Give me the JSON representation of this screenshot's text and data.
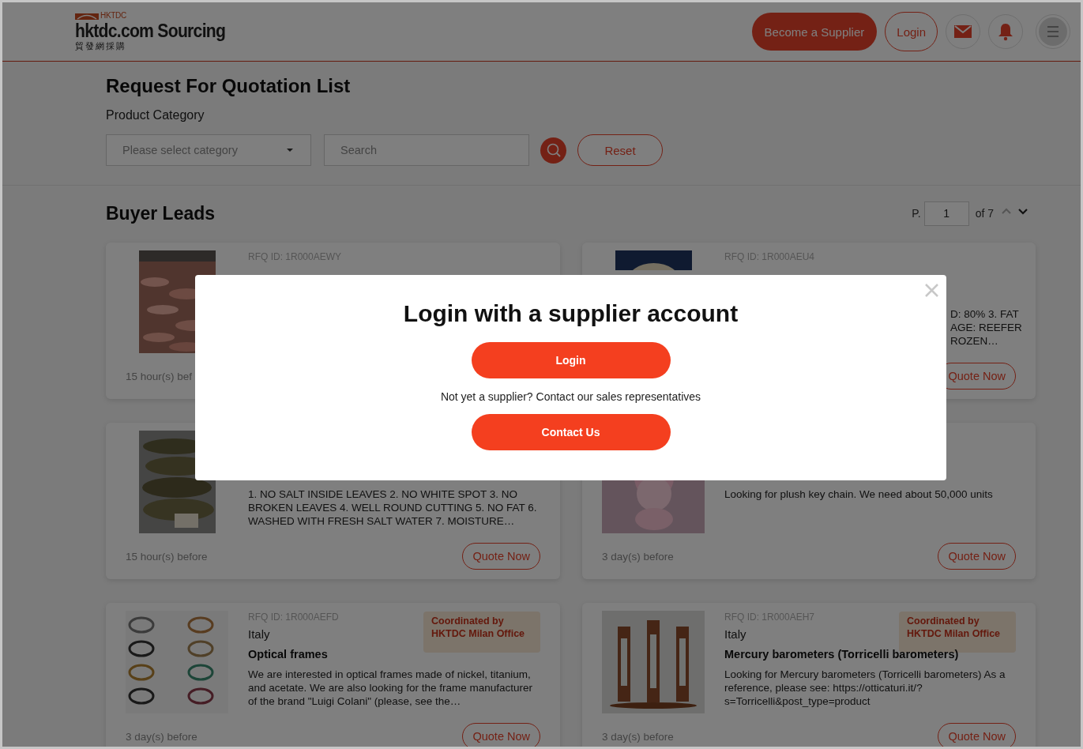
{
  "header": {
    "logo_mark": "HKTDC",
    "logo_title": "hktdc.com Sourcing",
    "logo_subtitle": "貿發網採購",
    "buttons": [
      {
        "label": "Become a Supplier",
        "kind": "filled"
      },
      {
        "label": "Login",
        "kind": "outline"
      }
    ]
  },
  "filter": {
    "title": "Request For Quotation List",
    "category_label": "Product Category",
    "category_select": {
      "placeholder": "Please select category"
    },
    "search_field": {
      "placeholder": "Search"
    },
    "reset_button": "Reset"
  },
  "buyer_leads": {
    "title": "Buyer Leads",
    "pager": {
      "prefix": "P.",
      "page": "1",
      "suffix": "of 7"
    },
    "cards": [
      {
        "rfq_id": "RFQ ID: 1R000AEWY",
        "posted": "15 hour(s) bef"
      },
      {
        "rfq_id": "RFQ ID: 1R000AEU4",
        "description_fragments": [
          "D: 80% 3. FAT",
          "AGE: REEFER",
          "ROZEN…"
        ],
        "quote_button": "Quote Now"
      },
      {
        "description": "1. NO SALT INSIDE LEAVES 2. NO WHITE SPOT 3. NO BROKEN LEAVES 4. WELL ROUND CUTTING 5. NO FAT 6. WASHED WITH FRESH SALT WATER 7. MOISTURE…",
        "posted": "15 hour(s) before",
        "quote_button": "Quote Now"
      },
      {
        "description": "Looking for plush key chain. We need about 50,000 units",
        "posted": "3 day(s) before",
        "quote_button": "Quote Now"
      },
      {
        "rfq_id": "RFQ ID: 1R000AEFD",
        "country": "Italy",
        "title": "Optical frames",
        "badge": "Coordinated by HKTDC Milan Office",
        "description": "We are interested in optical frames made of nickel, titanium, and acetate. We are also looking for the frame manufacturer of the brand \"Luigi Colani\" (please, see the…",
        "posted": "3 day(s) before",
        "quote_button": "Quote Now"
      },
      {
        "rfq_id": "RFQ ID: 1R000AEH7",
        "country": "Italy",
        "title": "Mercury barometers (Torricelli barometers)",
        "badge": "Coordinated by HKTDC Milan Office",
        "description": "Looking for Mercury barometers (Torricelli barometers) As a reference, please see: https://otticaturi.it/?s=Torricelli&post_type=product",
        "posted": "3 day(s) before",
        "quote_button": "Quote Now"
      }
    ]
  },
  "modal": {
    "title": "Login with a supplier account",
    "login_button": "Login",
    "prompt": "Not yet a supplier? Contact our sales representatives",
    "contact_button": "Contact Us"
  }
}
